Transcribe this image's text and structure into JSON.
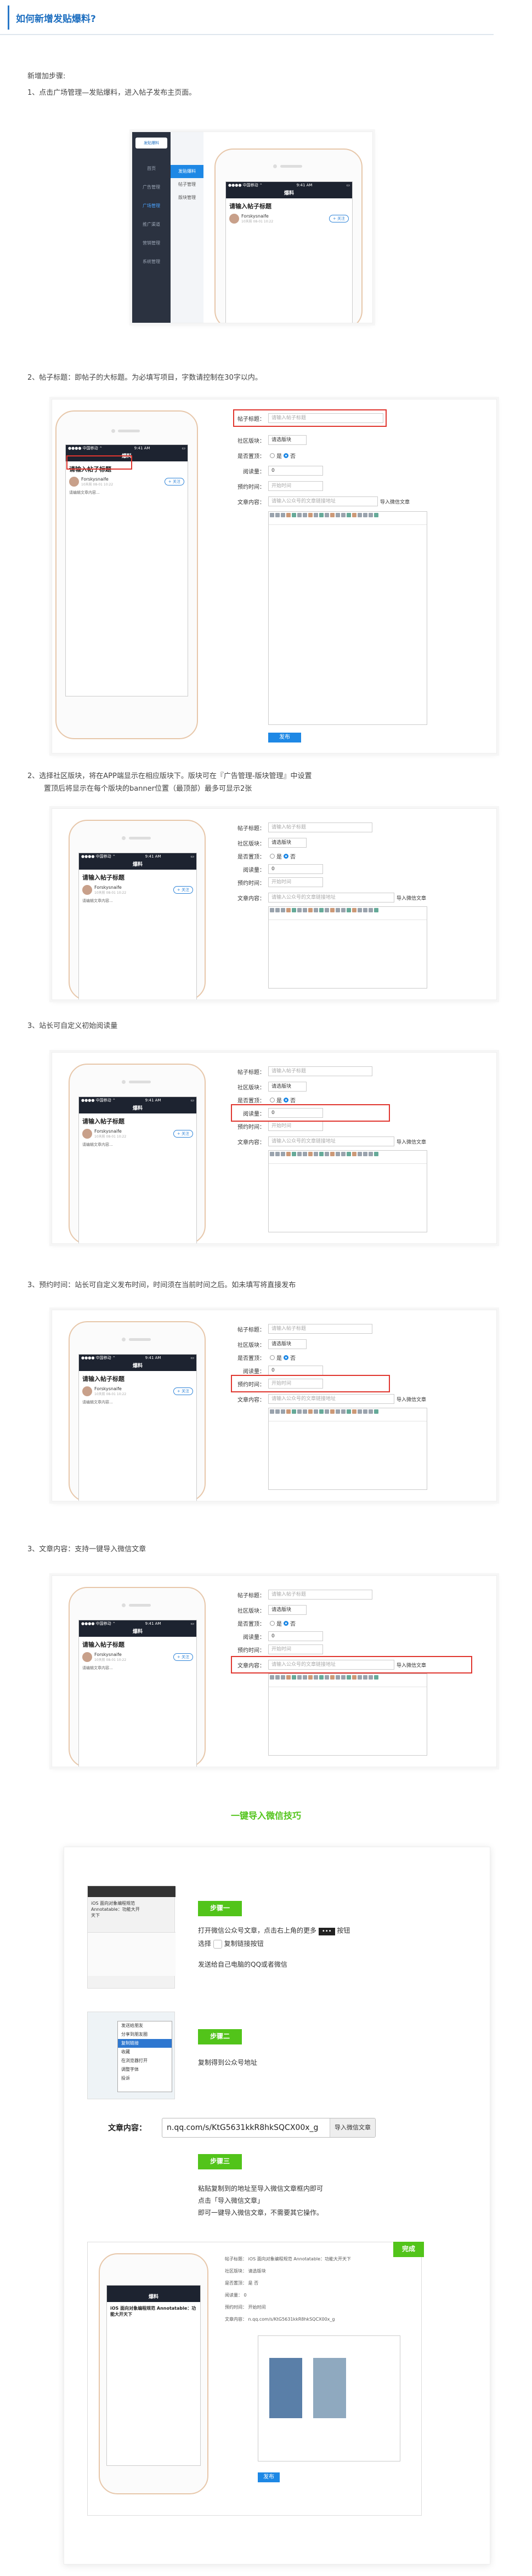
{
  "title": "如何新增发贴爆料?",
  "intro": "新增加步骤:",
  "steps": {
    "s1": "1、点击广场管理—发贴爆料，进入帖子发布主页面。",
    "s2": "2、帖子标题：即帖子的大标题。为必填写项目，字数请控制在30字以内。",
    "s3a": "2、选择社区版块，将在APP端显示在相应版块下。版块可在『广告管理-版块管理』中设置",
    "s3b": "置顶后将显示在每个版块的banner位置（最顶部）最多可显示2张",
    "s4": "3、站长可自定义初始阅读量",
    "s5": "3、预约时间：站长可自定义发布时间，时间须在当前时间之后。如未填写将直接发布",
    "s6": "3、文章内容：支持一键导入微信文章"
  },
  "admin": {
    "logo": "发贴爆料",
    "side": [
      "首页",
      "广告管理",
      "广场管理",
      "推广渠道",
      "营销管理",
      "系统管理"
    ],
    "menu": [
      "发贴爆料",
      "帖子管理",
      "版块管理"
    ]
  },
  "phone": {
    "status_left": "●●●● 中国移动 ⌃",
    "status_mid": "9:41 AM",
    "status_right": "▭",
    "nav": "爆料",
    "nav_edit": "同意",
    "title_ph": "请输入帖子标题",
    "user": "Forskysnaife",
    "time": "10天前 08-01 10:22",
    "follow": "+ 关注",
    "text_ph": "请编辑文章内容..."
  },
  "form": {
    "l_title": "帖子标题：",
    "ph_title": "请输入帖子标题",
    "l_board": "社区版块：",
    "board_val": "请选版块",
    "l_top": "是否置顶：",
    "top_yes": "是",
    "top_no": "否",
    "l_read": "阅读量：",
    "read_val": "0",
    "l_time": "预约时间：",
    "time_ph": "开始时间",
    "l_content": "文章内容：",
    "content_ph": "请输入公众号的文章链接地址",
    "import": "导入微信文章",
    "submit": "发布"
  },
  "tips": {
    "heading": "一键导入微信技巧",
    "step1": "步骤一",
    "step1_text": [
      "打开微信公众号文章，点击右上角的更多",
      "按钮",
      "选择",
      "复制链接按钮",
      "发送给自己电脑的QQ或者微信"
    ],
    "step2": "步骤二",
    "step2_text": "复制得到公众号地址",
    "url_label": "文章内容：",
    "url_value": "n.qq.com/s/KtG5631kkR8hkSQCX00x_g",
    "url_btn": "导入微信文章",
    "step3": "步骤三",
    "step3_text": [
      "粘贴复制到的地址至导入微信文章框内即可",
      "点击「导入微信文章」",
      "即可一键导入微信文章，不需要其它操作。"
    ],
    "done": "完成",
    "article_title": "iOS 面向对象编程规范 Annotatable：功能大开天下",
    "article_body": "iOS 面向对象编程规范 Annotatable：功能大开天下",
    "menu": [
      "发送给朋友",
      "分享到朋友圈",
      "收藏",
      "复制链接",
      "在浏览器打开",
      "调整字体",
      "投诉"
    ],
    "menu_sel": "复制链接"
  }
}
